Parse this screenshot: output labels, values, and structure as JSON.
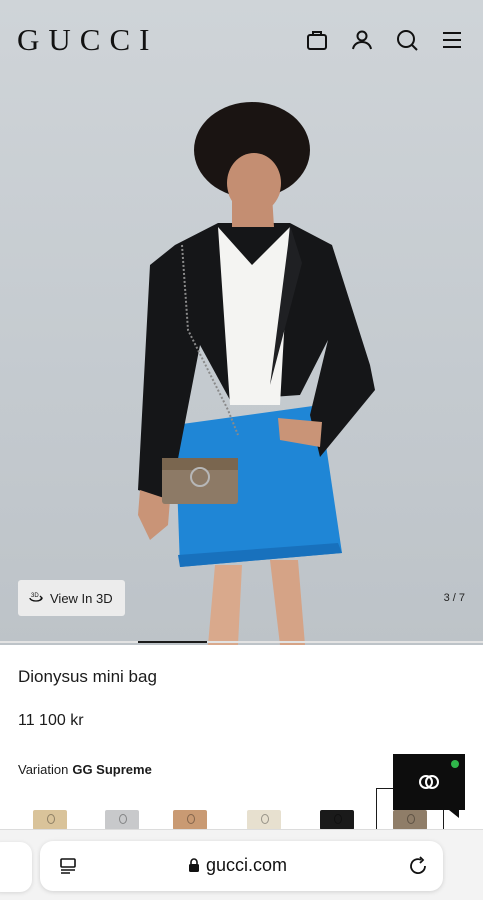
{
  "header": {
    "logo": "GUCCI",
    "icons": [
      "shopping-bag-icon",
      "account-icon",
      "search-icon",
      "menu-icon"
    ]
  },
  "gallery": {
    "view3d_label": "View In 3D",
    "counter": "3 / 7",
    "current_index": 3,
    "total": 7
  },
  "product": {
    "name": "Dionysus mini bag",
    "price": "11 100 kr",
    "variation_label": "Variation",
    "variation_value": "GG Supreme",
    "swatches": [
      {
        "color": "#d9c39a",
        "selected": false
      },
      {
        "color": "#c8c9cb",
        "selected": false
      },
      {
        "color": "#c99a73",
        "selected": false
      },
      {
        "color": "#e7e0cf",
        "selected": false
      },
      {
        "color": "#1a1a1a",
        "selected": false
      },
      {
        "color": "#8f7d68",
        "selected": true
      }
    ]
  },
  "chat": {
    "icon": "gucci-gg-chat-icon",
    "status_color": "#2fb54a"
  },
  "browser": {
    "url": "gucci.com"
  }
}
